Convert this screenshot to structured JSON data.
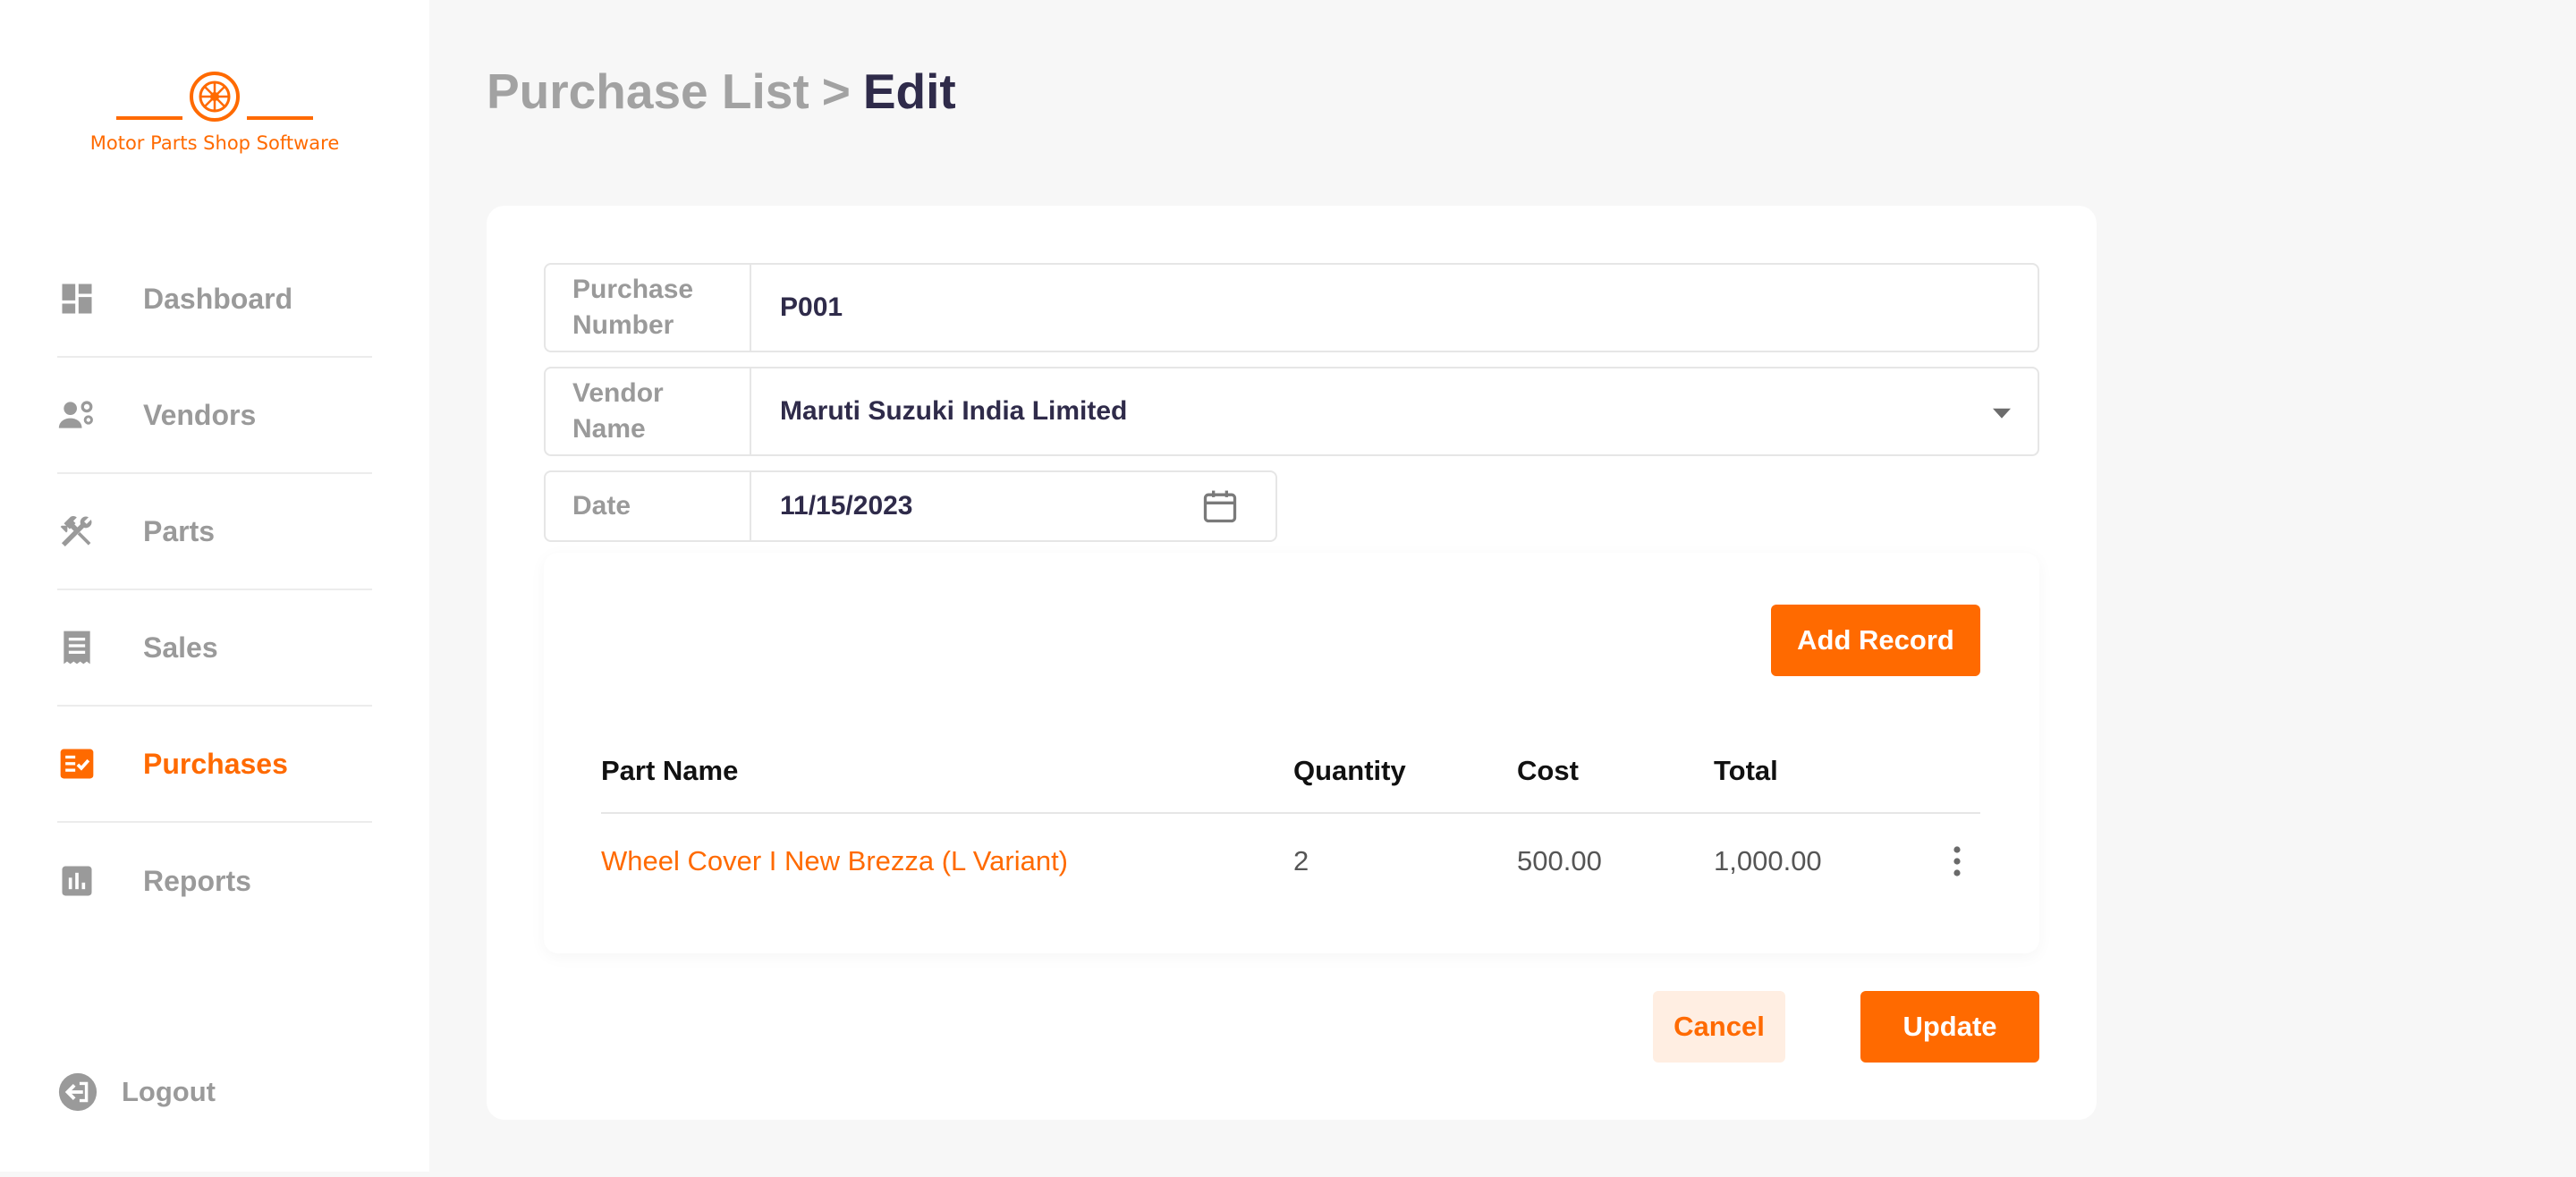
{
  "brand": {
    "name": "Motor Parts Shop Software",
    "accent": "#ff6a00",
    "logo_icon": "wheel-icon"
  },
  "sidebar": {
    "items": [
      {
        "label": "Dashboard",
        "icon": "dashboard-icon",
        "active": false
      },
      {
        "label": "Vendors",
        "icon": "vendors-icon",
        "active": false
      },
      {
        "label": "Parts",
        "icon": "tools-icon",
        "active": false
      },
      {
        "label": "Sales",
        "icon": "receipt-icon",
        "active": false
      },
      {
        "label": "Purchases",
        "icon": "checklist-icon",
        "active": true
      },
      {
        "label": "Reports",
        "icon": "bar-chart-icon",
        "active": false
      }
    ],
    "logout_label": "Logout"
  },
  "header": {
    "parent": "Purchase List",
    "separator": ">",
    "current": "Edit"
  },
  "form": {
    "purchase_number": {
      "label": "Purchase Number",
      "value": "P001"
    },
    "vendor_name": {
      "label": "Vendor Name",
      "value": "Maruti Suzuki India Limited"
    },
    "date": {
      "label": "Date",
      "value": "11/15/2023"
    }
  },
  "records": {
    "add_label": "Add Record",
    "columns": [
      "Part Name",
      "Quantity",
      "Cost",
      "Total"
    ],
    "rows": [
      {
        "part_name": "Wheel Cover I New Brezza (L Variant)",
        "quantity": "2",
        "cost": "500.00",
        "total": "1,000.00"
      }
    ]
  },
  "actions": {
    "cancel_label": "Cancel",
    "update_label": "Update"
  }
}
